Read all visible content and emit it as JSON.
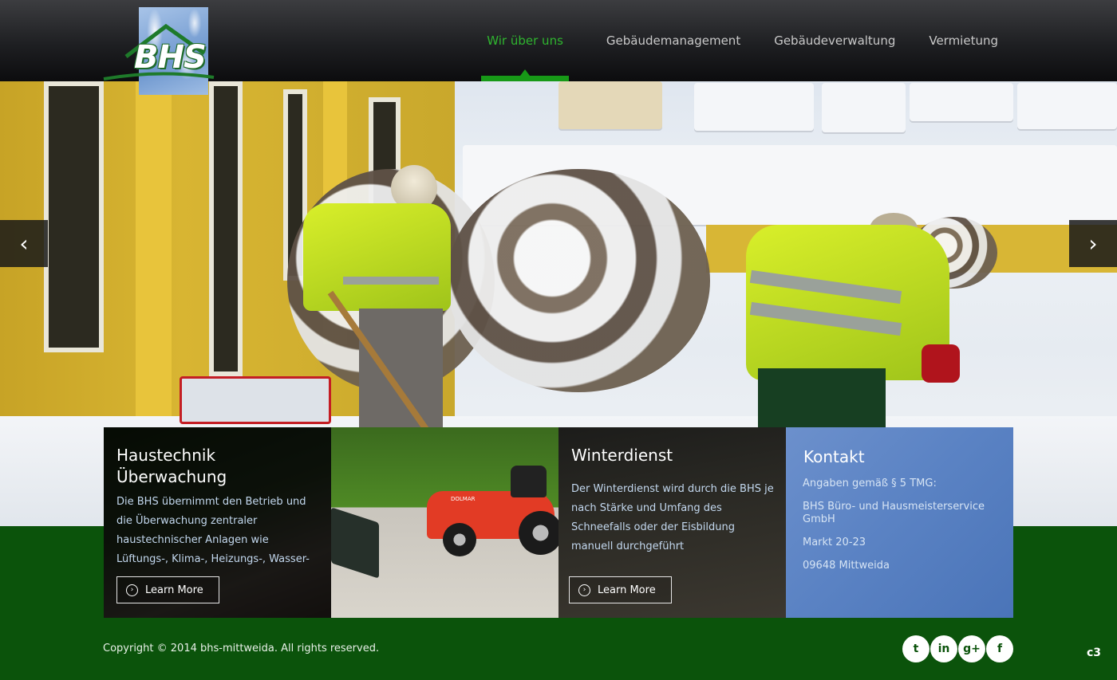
{
  "header": {
    "logo_text": "BHS",
    "nav": [
      {
        "label": "Wir über uns",
        "active": true
      },
      {
        "label": "Gebäudemanagement",
        "active": false
      },
      {
        "label": "Gebäudeverwaltung",
        "active": false
      },
      {
        "label": "Vermietung",
        "active": false
      }
    ]
  },
  "slider": {
    "prev_icon": "chevron-left-icon",
    "next_icon": "chevron-right-icon",
    "prev_glyph": "‹",
    "next_glyph": "›"
  },
  "boxes": {
    "haustechnik": {
      "title_line1": "Haustechnik",
      "title_line2": "Überwachung",
      "text": "Die BHS übernimmt den Betrieb und die Überwachung zentraler haustechnischer Anlagen wie Lüftungs-, Klima-, Heizungs-, Wasser- und Elektroanlagen.",
      "button": "Learn More"
    },
    "winterdienst": {
      "title": "Winterdienst",
      "text": "Der Winterdienst wird durch die BHS  je nach Stärke und Umfang des Schneefalls oder der Eisbildung manuell durchgeführt (Schneeschaufel) oder es wird mit Maschinen geräumt.",
      "button": "Learn More"
    },
    "kontakt": {
      "title": "Kontakt",
      "line1": "Angaben gemäß § 5 TMG:",
      "line2": "BHS Büro- und Hausmeisterservice GmbH",
      "line3": "Markt 20-23",
      "line4": "09648 Mittweida"
    }
  },
  "mower_label": "DOLMAR",
  "footer": {
    "copyright": "Copyright © 2014 bhs-mittweida. All rights reserved.",
    "social": [
      {
        "name": "twitter-icon",
        "glyph": "t"
      },
      {
        "name": "linkedin-icon",
        "glyph": "in"
      },
      {
        "name": "google-plus-icon",
        "glyph": "g+"
      },
      {
        "name": "facebook-icon",
        "glyph": "f"
      }
    ],
    "corner_tag": "c3"
  },
  "colors": {
    "brand_green": "#179917",
    "footer_green": "#0b530b",
    "contact_blue": "#5b83c4"
  }
}
